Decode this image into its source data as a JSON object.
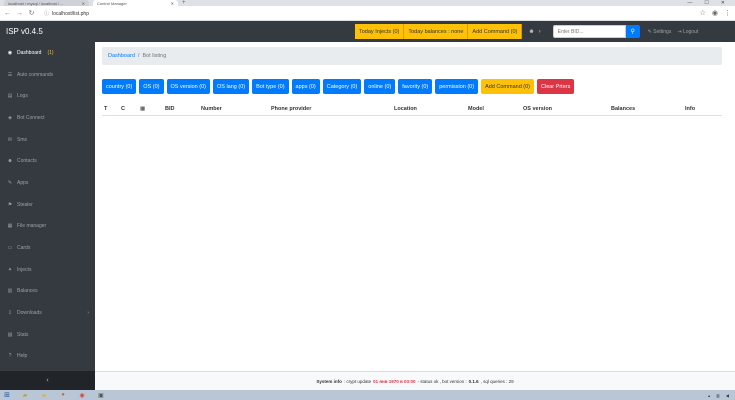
{
  "browser": {
    "tabs": [
      {
        "title": "localhost / mysql / localhost / ...",
        "active": false
      },
      {
        "title": "Control Manager",
        "active": true
      }
    ],
    "url": "localhost/list.php"
  },
  "header": {
    "brand": "ISP v0.4.5",
    "buttons": [
      "Today Injects (0)",
      "Today balances : none",
      "Add Command (0)"
    ],
    "search_placeholder": "Enter BID...",
    "links": [
      "Settings",
      "Logout"
    ]
  },
  "sidebar": {
    "items": [
      {
        "icon": "dashboard-icon",
        "glyph": "◉",
        "label": "Dashboard",
        "badge": "(1)",
        "active": true
      },
      {
        "icon": "list-icon",
        "glyph": "☰",
        "label": "Auto commands"
      },
      {
        "icon": "logs-icon",
        "glyph": "▤",
        "label": "Logs"
      },
      {
        "icon": "bot-icon",
        "glyph": "◈",
        "label": "Bot Connect"
      },
      {
        "icon": "sms-icon",
        "glyph": "✉",
        "label": "Sms"
      },
      {
        "icon": "contacts-icon",
        "glyph": "☻",
        "label": "Contacts"
      },
      {
        "icon": "apps-icon",
        "glyph": "✎",
        "label": "Apps"
      },
      {
        "icon": "stealer-icon",
        "glyph": "⚑",
        "label": "Stealer"
      },
      {
        "icon": "file-icon",
        "glyph": "▦",
        "label": "File manager"
      },
      {
        "icon": "cards-icon",
        "glyph": "▭",
        "label": "Cards"
      },
      {
        "icon": "injects-icon",
        "glyph": "✦",
        "label": "Injects"
      },
      {
        "icon": "balances-icon",
        "glyph": "▥",
        "label": "Balances"
      },
      {
        "icon": "download-icon",
        "glyph": "⇩",
        "label": "Downloads",
        "arrow": true
      },
      {
        "icon": "stats-icon",
        "glyph": "▨",
        "label": "Stats"
      },
      {
        "icon": "help-icon",
        "glyph": "?",
        "label": "Help"
      }
    ]
  },
  "breadcrumb": {
    "root": "Dashboard",
    "current": "Bot listing"
  },
  "filters": [
    {
      "label": "country (0)",
      "style": "primary"
    },
    {
      "label": "OS (0)",
      "style": "primary"
    },
    {
      "label": "OS version (0)",
      "style": "primary"
    },
    {
      "label": "OS lang (0)",
      "style": "primary"
    },
    {
      "label": "Bot type (0)",
      "style": "primary"
    },
    {
      "label": "apps (0)",
      "style": "primary"
    },
    {
      "label": "Category (0)",
      "style": "primary"
    },
    {
      "label": "online (0)",
      "style": "primary"
    },
    {
      "label": "favority (0)",
      "style": "primary"
    },
    {
      "label": "permission (0)",
      "style": "primary"
    },
    {
      "label": "Add Command (0)",
      "style": "warn"
    },
    {
      "label": "Clear Prters",
      "style": "danger"
    }
  ],
  "table": {
    "columns": [
      "T",
      "C",
      "",
      "BID",
      "Number",
      "Phone provider",
      "Location",
      "Model",
      "OS version",
      "Balances",
      "Info"
    ]
  },
  "footer": {
    "label": "System info",
    "crypt_label": ": crypt update",
    "crypt_value": "01 янв 1970 в 03:00",
    "status": "- status ok , bot version :",
    "version": "0.1.6",
    "tail": ", sql queries : 29"
  },
  "colors": {
    "primary": "#007bff",
    "warn": "#ffc107",
    "danger": "#dc3545",
    "dark": "#343a40"
  }
}
